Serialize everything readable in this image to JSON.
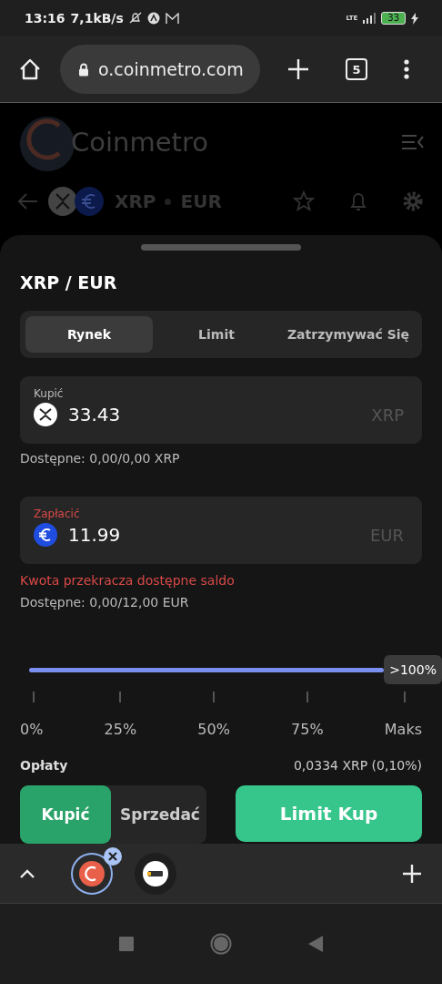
{
  "status_bar": {
    "time": "13:16",
    "speed": "7,1kB/s",
    "network": "LTE",
    "battery": "33"
  },
  "browser": {
    "url": "o.coinmetro.com",
    "tab_count": "5"
  },
  "page": {
    "brand": "Coinmetro",
    "base": "XRP",
    "quote": "EUR"
  },
  "sheet": {
    "title": "XRP / EUR",
    "order_types": [
      {
        "label": "Rynek",
        "selected": true
      },
      {
        "label": "Limit",
        "selected": false
      },
      {
        "label": "Zatrzymywać Się",
        "selected": false
      }
    ],
    "buy_field": {
      "label": "Kupić",
      "value": "33.43",
      "unit": "XRP",
      "error": false
    },
    "buy_available": "Dostępne: 0,00/0,00 XRP",
    "pay_field": {
      "label": "Zapłacić",
      "value": "11.99",
      "unit": "EUR",
      "error": true
    },
    "error_message": "Kwota przekracza dostępne saldo",
    "pay_available": "Dostępne: 0,00/12,00 EUR",
    "slider": {
      "badge": ">100%",
      "ticks": [
        "0%",
        "25%",
        "50%",
        "75%",
        "Maks"
      ]
    },
    "fees": {
      "label": "Opłaty",
      "value": "0,0334 XRP (0,10%)"
    },
    "sides": [
      {
        "label": "Kupić",
        "selected": true
      },
      {
        "label": "Sprzedać",
        "selected": false
      }
    ],
    "submit": "Limit Kup"
  }
}
